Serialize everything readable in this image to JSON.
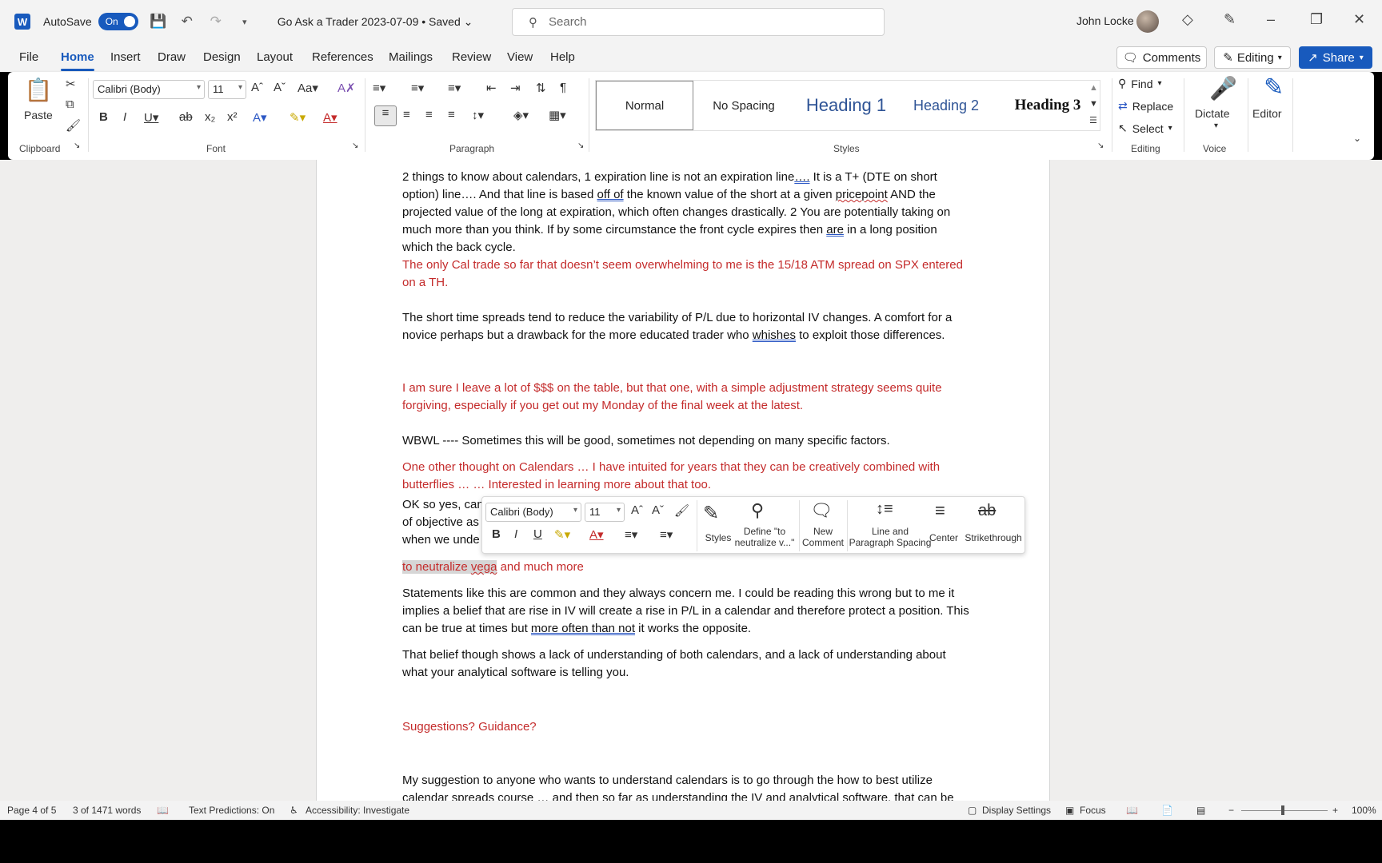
{
  "titlebar": {
    "autosave_label": "AutoSave",
    "autosave_state": "On",
    "doc_title": "Go Ask a Trader 2023-07-09 • Saved",
    "search_placeholder": "Search",
    "user_name": "John Locke"
  },
  "menu": {
    "tabs": [
      "File",
      "Home",
      "Insert",
      "Draw",
      "Design",
      "Layout",
      "References",
      "Mailings",
      "Review",
      "View",
      "Help"
    ],
    "comments": "Comments",
    "editing": "Editing",
    "share": "Share"
  },
  "ribbon": {
    "paste": "Paste",
    "font_name": "Calibri (Body)",
    "font_size": "11",
    "groups": {
      "clipboard": "Clipboard",
      "font": "Font",
      "paragraph": "Paragraph",
      "styles": "Styles",
      "editing": "Editing",
      "voice": "Voice"
    },
    "styles": [
      "Normal",
      "No Spacing",
      "Heading 1",
      "Heading 2",
      "Heading 3"
    ],
    "find": "Find",
    "replace": "Replace",
    "select": "Select",
    "dictate": "Dictate",
    "editor": "Editor"
  },
  "document": {
    "p1a": "2 things to know about calendars, 1 expiration line is not an expiration line",
    "p1b": "….",
    "p1c": " It is a T+ (DTE on short option) line…. And that line is based ",
    "p1d": "off of",
    "p1e": " the known value of the short at a given ",
    "p1f": "pricepoint",
    "p1g": " AND the projected value of the long at expiration, which often changes drastically.   2 You are potentially taking on much more than you think. If by some circumstance the front cycle expires then ",
    "p1h": "are",
    "p1i": " in a long position which the back cycle.",
    "p2": "The only Cal trade so far that doesn’t seem overwhelming to me is the 15/18 ATM spread on SPX entered on a TH.",
    "p3a": "The short time spreads tend to reduce the variability of P/L due to horizontal IV changes. A comfort for a novice perhaps but a drawback for the more educated trader who ",
    "p3b": "whishes",
    "p3c": " to exploit those differences.",
    "p4": "I am sure I leave a lot of $$$ on the table, but that one, with a simple adjustment strategy seems quite forgiving, especially if you get out my Monday of the final week at the latest.",
    "p5": "WBWL ---- Sometimes this will be good, sometimes not depending on many specific factors.",
    "p6": "One other thought on Calendars … I have intuited for years that they can be creatively combined with butterflies … … Interested in learning more about that too.",
    "p7l1": "OK so yes, can",
    "p7l2": "of objective as",
    "p7l3": "when we unde",
    "p8a": "to neutralize ",
    "p8b": "vega",
    "p8c": " and much more",
    "p9a": "Statements like this are common and they always concern me. I could be reading this wrong but to me it implies a belief that are rise in IV will create a rise in P/L in a calendar and therefore protect a position. This can be true at times but ",
    "p9b": "more often than not",
    "p9c": " it works the opposite.",
    "p10": "That belief though shows a lack of understanding of both calendars, and a lack of understanding about what your analytical software is telling you.",
    "p11": "Suggestions? Guidance?",
    "p12": "My suggestion to anyone who wants to understand calendars is to go through the how to best utilize calendar spreads course … and then so far as understanding the IV and analytical software, that can be"
  },
  "mini_toolbar": {
    "font_name": "Calibri (Body)",
    "font_size": "11",
    "styles": "Styles",
    "define_l1": "Define \"to",
    "define_l2": "neutralize v...\"",
    "new_l1": "New",
    "new_l2": "Comment",
    "spacing_l1": "Line and",
    "spacing_l2": "Paragraph Spacing",
    "center": "Center",
    "strike": "Strikethrough"
  },
  "status": {
    "page": "Page 4 of 5",
    "words": "3 of 1471 words",
    "predictions": "Text Predictions: On",
    "accessibility": "Accessibility: Investigate",
    "display": "Display Settings",
    "focus": "Focus",
    "zoom": "100%"
  },
  "colors": {
    "accent": "#185abd",
    "red_text": "#c42b2b"
  }
}
